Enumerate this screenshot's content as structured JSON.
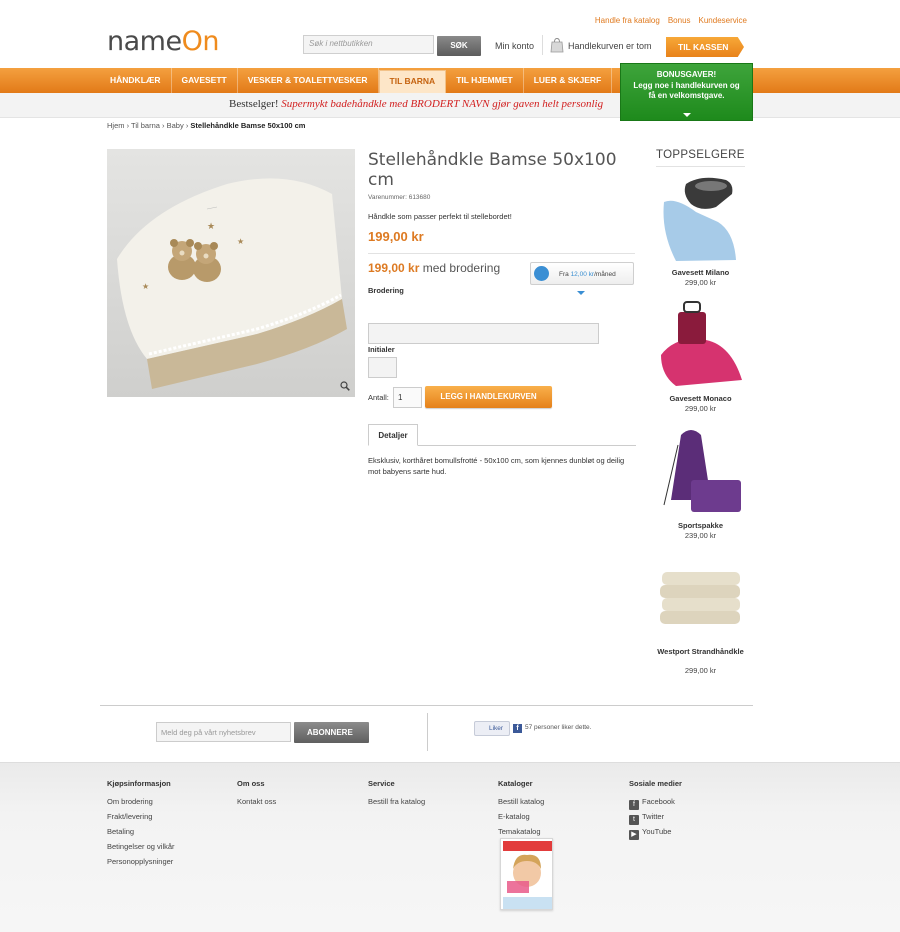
{
  "header": {
    "top_links": [
      "Handle fra katalog",
      "Bonus",
      "Kundeservice"
    ],
    "logo_name": "name",
    "logo_on": "On",
    "search_placeholder": "Søk i nettbutikken",
    "search_button": "SØK",
    "account": "Min konto",
    "cart": "Handlekurven er tom",
    "checkout": "TIL KASSEN"
  },
  "nav": {
    "items": [
      "HÅNDKLÆR",
      "GAVESETT",
      "VESKER & TOALETTVESKER",
      "TIL BARNA",
      "TIL HJEMMET",
      "LUER & SKJERF"
    ],
    "active_index": 3
  },
  "bonus": {
    "title": "BONUSGAVER!",
    "line1": "Legg noe i handlekurven og",
    "line2": "få en velkomstgave."
  },
  "promo": {
    "lead": "Bestselger!",
    "text": "Supermykt badehåndkle med BRODERT NAVN gjør gaven helt personlig"
  },
  "breadcrumb": {
    "items": [
      "Hjem",
      "Til barna",
      "Baby"
    ],
    "current": "Stellehåndkle Bamse 50x100 cm"
  },
  "product": {
    "title": "Stellehåndkle Bamse 50x100 cm",
    "sku": "Varenummer: 613680",
    "short_desc": "Håndkle som passer perfekt til stellebordet!",
    "price": "199,00 kr",
    "price_embroidery": "199,00 kr",
    "embroidery_suffix": "med brodering",
    "installment_prefix": "Fra",
    "installment_amount": "12,00 kr",
    "installment_suffix": "/måned",
    "embroidery_label": "Brodering",
    "initials_label": "Initialer",
    "qty_label": "Antall:",
    "qty_value": "1",
    "add_to_cart": "LEGG I HANDLEKURVEN",
    "tab": "Detaljer",
    "long_desc": "Eksklusiv, korthåret bomullsfrotté - 50x100 cm, som kjennes dunbløt og deilig mot babyens sarte hud."
  },
  "top_sellers": {
    "title": "TOPPSELGERE",
    "items": [
      {
        "name": "Gavesett Milano",
        "price": "299,00 kr"
      },
      {
        "name": "Gavesett Monaco",
        "price": "299,00 kr"
      },
      {
        "name": "Sportspakke",
        "price": "239,00 kr"
      },
      {
        "name": "Westport Strandhåndkle",
        "price": "299,00 kr"
      }
    ]
  },
  "newsletter": {
    "placeholder": "Meld deg på vårt nyhetsbrev",
    "button": "ABONNERE"
  },
  "facebook": {
    "like": "Liker",
    "count_text": "57 personer liker dette."
  },
  "footer": {
    "columns": [
      {
        "title": "Kjøpsinformasjon",
        "links": [
          "Om brodering",
          "Frakt/levering",
          "Betaling",
          "Betingelser og vilkår",
          "Personopplysninger"
        ]
      },
      {
        "title": "Om oss",
        "links": [
          "Kontakt oss"
        ]
      },
      {
        "title": "Service",
        "links": [
          "Bestill fra katalog"
        ]
      },
      {
        "title": "Kataloger",
        "links": [
          "Bestill katalog",
          "E-katalog",
          "Temakatalog"
        ]
      },
      {
        "title": "Sosiale medier",
        "links": [
          "Facebook",
          "Twitter",
          "YouTube"
        ]
      }
    ]
  },
  "colors": {
    "accent_orange": "#e8821a",
    "bonus_green": "#1e8a1c",
    "price_orange": "#dd7a22"
  }
}
